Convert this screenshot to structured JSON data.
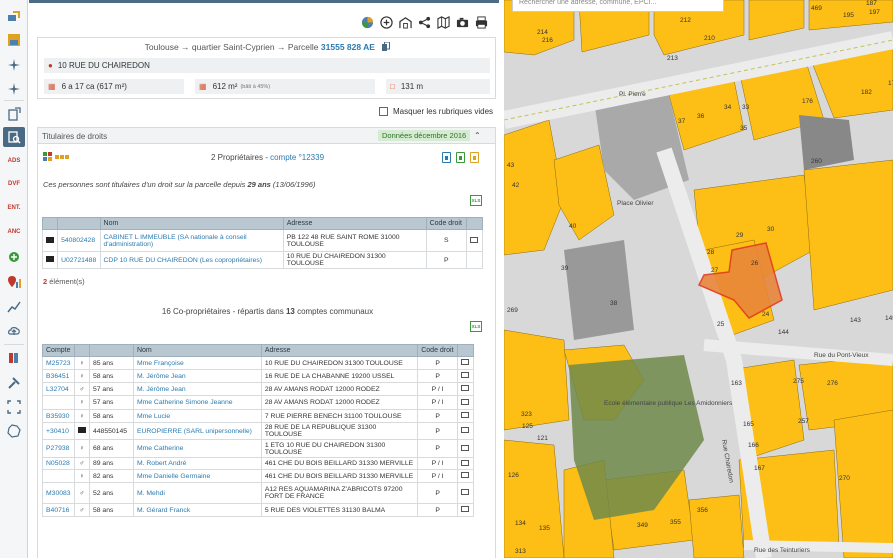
{
  "breadcrumb": {
    "prefix": "Toulouse → quartier Saint-Cyprien → Parcelle",
    "parcel_id": "31555 828 AE"
  },
  "parcel": {
    "address": "10 RUE DU CHAIREDON",
    "area": "6 a 17 ca (617 m²)",
    "built_area": "612 m²",
    "built_area_note": "(bâti à 45%)",
    "perimeter": "131 m"
  },
  "toggle_label": "Masquer les rubriques vides",
  "section": {
    "title": "Titulaires de droits",
    "badge": "Données décembre 2016"
  },
  "owners": {
    "count_text": "2 Propriétaires - ",
    "account_link": "compte °12339",
    "note_prefix": "Ces personnes sont titulaires d'un droit sur la parcelle depuis ",
    "note_years": "29 ans",
    "note_date": " (13/06/1996)",
    "headers": [
      "",
      "",
      "Nom",
      "Adresse",
      "Code droit",
      ""
    ],
    "rows": [
      {
        "id": "540802428",
        "name": "CABINET L IMMEUBLE (SA nationale à conseil d'administration)",
        "address": "PB 122 48 RUE SAINT ROME 31000 TOULOUSE",
        "code": "S"
      },
      {
        "id": "U02721488",
        "name": "CDP 10 RUE DU CHAIREDON (Les copropriétaires)",
        "address": "10 RUE DU CHAIREDON 31300 TOULOUSE",
        "code": "P"
      }
    ],
    "element_count_num": "2",
    "element_count_text": " élément(s)"
  },
  "coowners": {
    "summary_prefix": "16 Co-propriétaires - répartis dans ",
    "summary_num": "13",
    "summary_suffix": " comptes communaux",
    "headers": [
      "Compte",
      "",
      "",
      "Nom",
      "Adresse",
      "Code droit",
      ""
    ],
    "rows": [
      {
        "account": "M25723",
        "type": "female",
        "age": "85 ans",
        "name": "Mme Françoise",
        "address": "10 RUE DU CHAIREDON 31300 TOULOUSE",
        "code": "P"
      },
      {
        "account": "B36451",
        "type": "female",
        "age": "58 ans",
        "name": "M. Jérôme Jean",
        "address": "16 RUE DE LA CHABANNE 19200 USSEL",
        "code": "P"
      },
      {
        "account": "L32704",
        "type": "male",
        "age": "57 ans",
        "name": "M. Jérôme Jean",
        "address": "28 AV AMANS RODAT 12000 RODEZ",
        "code": "P / I"
      },
      {
        "account": "",
        "type": "female",
        "age": "57 ans",
        "name": "Mme Catherine Simone Jeanne",
        "address": "28 AV AMANS RODAT 12000 RODEZ",
        "code": "P / I"
      },
      {
        "account": "B35930",
        "type": "female",
        "age": "58 ans",
        "name": "Mme Lucie",
        "address": "7 RUE PIERRE BENECH 31100 TOULOUSE",
        "code": "P"
      },
      {
        "account": "+30410",
        "type": "company",
        "age": "448550145",
        "name": "EUROPIERRE (SARL unipersonnelle)",
        "address": "28 RUE DE LA REPUBLIQUE 31300 TOULOUSE",
        "code": "P"
      },
      {
        "account": "P27938",
        "type": "female",
        "age": "68 ans",
        "name": "Mme Catherine",
        "address": "1 ETG 10 RUE DU CHAIREDON 31300 TOULOUSE",
        "code": "P"
      },
      {
        "account": "N05028",
        "type": "male",
        "age": "89 ans",
        "name": "M. Robert André",
        "address": "461 CHE DU BOIS BEILLARD 31330 MERVILLE",
        "code": "P / I"
      },
      {
        "account": "",
        "type": "female",
        "age": "82 ans",
        "name": "Mme Danielle Germaine",
        "address": "461 CHE DU BOIS BEILLARD 31330 MERVILLE",
        "code": "P / I"
      },
      {
        "account": "M30083",
        "type": "male",
        "age": "52 ans",
        "name": "M. Mehdi",
        "address": "A12 RES AQUAMARINA Z'ABRICOTS 97200 FORT DE FRANCE",
        "code": "P"
      },
      {
        "account": "B40716",
        "type": "male",
        "age": "58 ans",
        "name": "M. Gérard Franck",
        "address": "5 RUE DES VIOLETTES 31130 BALMA",
        "code": "P"
      }
    ]
  },
  "map": {
    "search_placeholder": "Rechercher une adresse, commune, EPCI...",
    "labels": [
      "212",
      "195",
      "187",
      "469",
      "197",
      "214",
      "216",
      "213",
      "210",
      "37",
      "36",
      "34",
      "33",
      "35",
      "176",
      "182",
      "178",
      "260",
      "28",
      "25",
      "26",
      "27",
      "24",
      "29",
      "30",
      "40",
      "39",
      "38",
      "144",
      "143",
      "145",
      "163",
      "275",
      "276",
      "165",
      "257",
      "166",
      "167",
      "270",
      "269",
      "126",
      "134",
      "135",
      "349",
      "355",
      "356",
      "313",
      "323",
      "125",
      "121",
      "42",
      "43"
    ],
    "place_labels": [
      "Place Olivier",
      "Rue du Pont-Vieux",
      "Rue Chairedon",
      "Rue des Teinturiers",
      "Ecole élémentaire publique Les Amidonniers",
      "Pl. Pierre"
    ],
    "colors": {
      "parcel_fill": "#fdbf16",
      "road": "#e0e0e0",
      "selected": "#e03a1e"
    }
  },
  "icons": [
    "layers-icon",
    "add-icon",
    "building-icon",
    "share-icon",
    "map-icon",
    "camera-icon",
    "print-icon"
  ]
}
